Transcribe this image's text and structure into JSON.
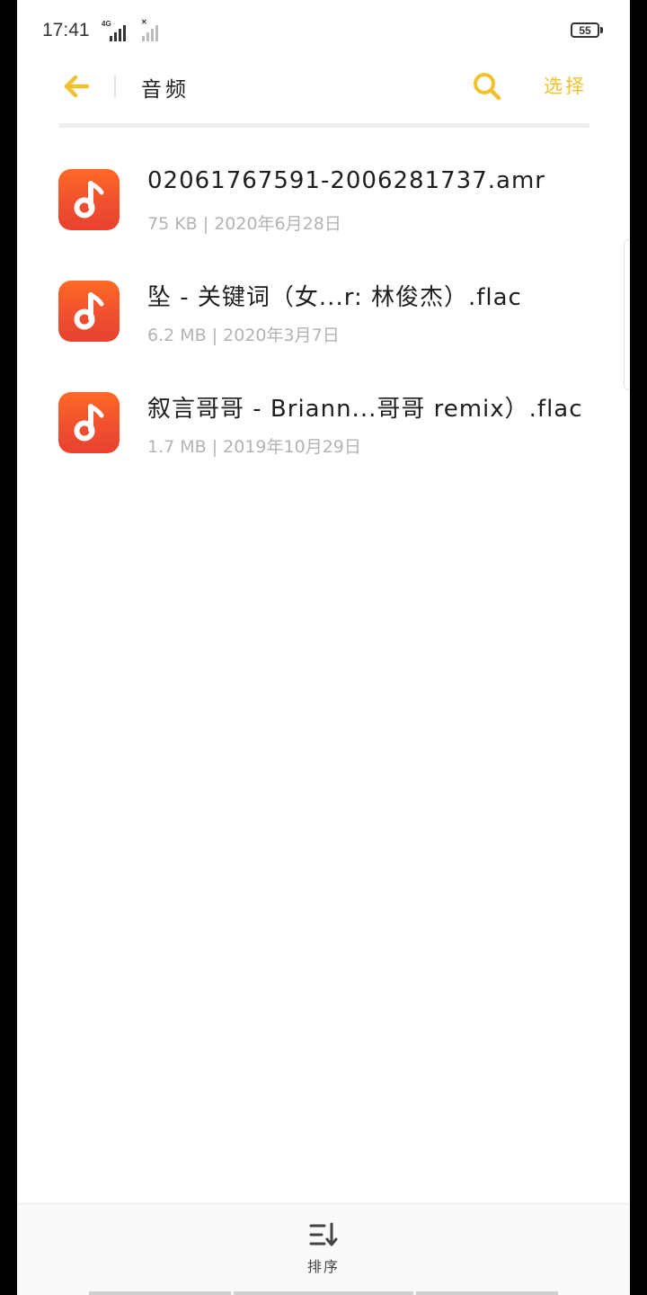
{
  "status_bar": {
    "time": "17:41",
    "network_label": "4G",
    "battery": "55",
    "icons": [
      "signal-icon",
      "signal-disabled-icon",
      "battery-icon"
    ]
  },
  "header": {
    "title": "音频",
    "select_label": "选择",
    "icons": [
      "back-arrow-icon",
      "search-icon"
    ],
    "accent_color": "#f2c12e"
  },
  "files": [
    {
      "name": "02061767591-2006281737.amr",
      "size": "75 KB",
      "date": "2020年6月28日",
      "icon": "music-note-icon"
    },
    {
      "name": "坠 - 关键词（女...r: 林俊杰）.flac",
      "size": "6.2 MB",
      "date": "2020年3月7日",
      "icon": "music-note-icon"
    },
    {
      "name": "叙言哥哥 - Briann...哥哥 remix）.flac",
      "size": "1.7 MB",
      "date": "2019年10月29日",
      "icon": "music-note-icon"
    }
  ],
  "bottom_bar": {
    "sort_label": "排序",
    "icon": "sort-icon"
  },
  "colors": {
    "icon_gradient_top": "#ff6a25",
    "icon_gradient_bottom": "#e8422f"
  }
}
